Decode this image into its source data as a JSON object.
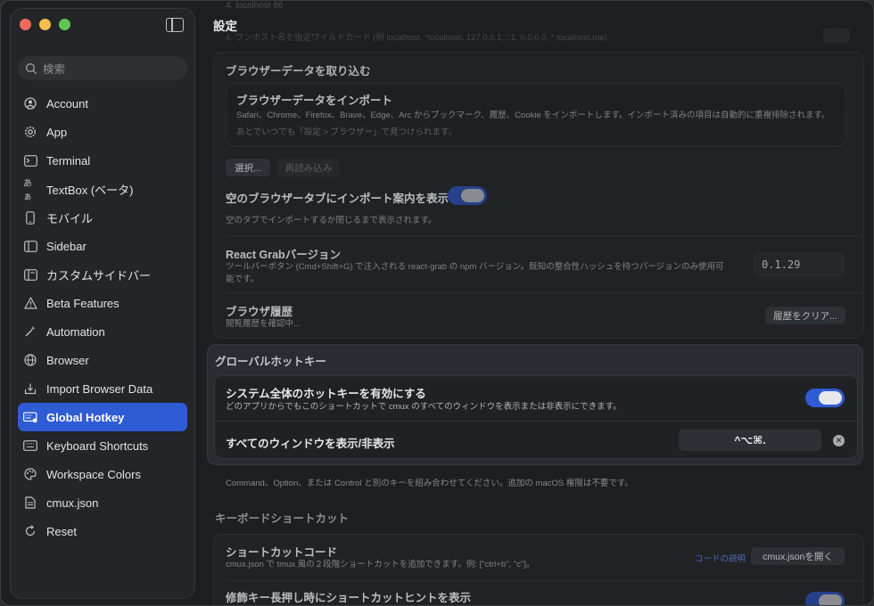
{
  "window": {
    "title": "設定"
  },
  "sidebar": {
    "search_placeholder": "検索",
    "items": [
      {
        "label": "Account",
        "icon": "person-circle-icon"
      },
      {
        "label": "App",
        "icon": "gear-icon"
      },
      {
        "label": "Terminal",
        "icon": "terminal-icon"
      },
      {
        "label": "TextBox (ベータ)",
        "icon": "text-aa-icon"
      },
      {
        "label": "モバイル",
        "icon": "phone-icon"
      },
      {
        "label": "Sidebar",
        "icon": "sidebar-icon"
      },
      {
        "label": "カスタムサイドバー",
        "icon": "sidebar-custom-icon"
      },
      {
        "label": "Beta Features",
        "icon": "warning-triangle-icon"
      },
      {
        "label": "Automation",
        "icon": "wand-icon"
      },
      {
        "label": "Browser",
        "icon": "globe-icon"
      },
      {
        "label": "Import Browser Data",
        "icon": "import-tray-icon"
      },
      {
        "label": "Global Hotkey",
        "icon": "keyboard-badge-icon",
        "active": true
      },
      {
        "label": "Keyboard Shortcuts",
        "icon": "keyboard-icon"
      },
      {
        "label": "Workspace Colors",
        "icon": "palette-icon"
      },
      {
        "label": "cmux.json",
        "icon": "document-icon"
      },
      {
        "label": "Reset",
        "icon": "reset-icon"
      }
    ]
  },
  "main": {
    "ghost_top": "4. localhost 86",
    "ghost_top2": "4. ワンホスト名を指定ワイルドカード (例 localhost, *localhost, 127.0.0.1, ::1, 0.0.0.0, *.localhost.me).",
    "browser_import": {
      "section_title": "ブラウザーデータを取り込む",
      "row_title": "ブラウザーデータをインポート",
      "row_desc": "Safari、Chrome、Firefox、Brave、Edge、Arc からブックマーク、履歴、Cookie をインポートします。インポート済みの項目は自動的に重複排除されます。",
      "row_desc2": "あとでいつでも「設定 > ブラウザー」で見つけられます。",
      "select_label": "選択...",
      "reload_label": "再読み込み",
      "empty_tab_title": "空のブラウザータブにインポート案内を表示",
      "empty_tab_desc": "空のタブでインポートするか閉じるまで表示されます。"
    },
    "react_grab": {
      "title": "React Grabバージョン",
      "desc": "ツールバーボタン (Cmd+Shift+G) で注入される react-grab の npm バージョン。既知の整合性ハッシュを持つバージョンのみ使用可能です。",
      "version": "0.1.29"
    },
    "history": {
      "title": "ブラウザ履歴",
      "desc": "閲覧履歴を確認中...",
      "clear_label": "履歴をクリア..."
    },
    "global_hotkey": {
      "section_title": "グローバルホットキー",
      "enable_title": "システム全体のホットキーを有効にする",
      "enable_desc": "どのアプリからでもこのショートカットで cmux のすべてのウィンドウを表示または非表示にできます。",
      "show_hide_title": "すべてのウィンドウを表示/非表示",
      "shortcut": "^⌥⌘.",
      "note": "Command、Option、または Control と別のキーを組み合わせてください。追加の macOS 権限は不要です。"
    },
    "keyboard": {
      "section_title": "キーボードショートカット",
      "code_title": "ショートカットコード",
      "code_desc": "cmux.json で tmux 風の２段階ショートカットを追加できます。例: [\"ctrl+b\", \"c\"]。",
      "code_link": "コードの説明",
      "open_json_label": "cmux.jsonを開く",
      "hint_title": "修飾キー長押し時にショートカットヒントを表示"
    }
  },
  "colors": {
    "accent": "#2f5bd4",
    "background": "#1c1e22"
  }
}
